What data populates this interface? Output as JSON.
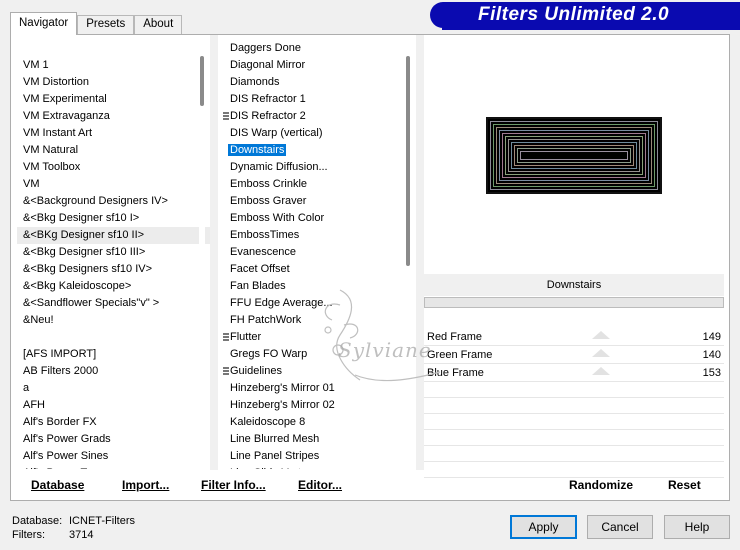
{
  "title": "Filters Unlimited 2.0",
  "tabs": [
    {
      "label": "Navigator"
    },
    {
      "label": "Presets"
    },
    {
      "label": "About"
    }
  ],
  "categories": [
    "VM 1",
    "VM Distortion",
    "VM Experimental",
    "VM Extravaganza",
    "VM Instant Art",
    "VM Natural",
    "VM Toolbox",
    "VM",
    "&<Background Designers IV>",
    "&<Bkg Designer sf10 I>",
    "&<BKg Designer sf10 II>",
    "&<Bkg Designer sf10 III>",
    "&<Bkg Designers sf10 IV>",
    "&<Bkg Kaleidoscope>",
    "&<Sandflower Specials\"v\" >",
    "&Neu!",
    "",
    "[AFS IMPORT]",
    "AB Filters 2000",
    "a",
    "AFH",
    "Alf's Border FX",
    "Alf's Power Grads",
    "Alf's Power Sines",
    "Alf's Power Toys"
  ],
  "filters": [
    "Daggers Done",
    "Diagonal Mirror",
    "Diamonds",
    "DIS Refractor 1",
    "DIS Refractor 2",
    "DIS Warp (vertical)",
    "Downstairs",
    "Dynamic Diffusion...",
    "Emboss Crinkle",
    "Emboss Graver",
    "Emboss With Color",
    "EmbossTimes",
    "Evanescence",
    "Facet Offset",
    "Fan Blades",
    "FFU Edge Average...",
    "FH PatchWork",
    "Flutter",
    "Gregs FO Warp",
    "Guidelines",
    "Hinzeberg's Mirror 01",
    "Hinzeberg's Mirror 02",
    "Kaleidoscope 8",
    "Line Blurred Mesh",
    "Line Panel Stripes",
    "Line Slide Vert"
  ],
  "selected_filter": "Downstairs",
  "params": [
    {
      "label": "Red Frame",
      "value": "149"
    },
    {
      "label": "Green Frame",
      "value": "140"
    },
    {
      "label": "Blue Frame",
      "value": "153"
    }
  ],
  "buttons": {
    "database": "Database",
    "import": "Import...",
    "filter_info": "Filter Info...",
    "editor": "Editor...",
    "randomize": "Randomize",
    "reset": "Reset",
    "apply": "Apply",
    "cancel": "Cancel",
    "help": "Help"
  },
  "status": {
    "database_label": "Database:",
    "database_value": "ICNET-Filters",
    "filters_label": "Filters:",
    "filters_value": "3714"
  },
  "watermark_text": "Sylviane"
}
